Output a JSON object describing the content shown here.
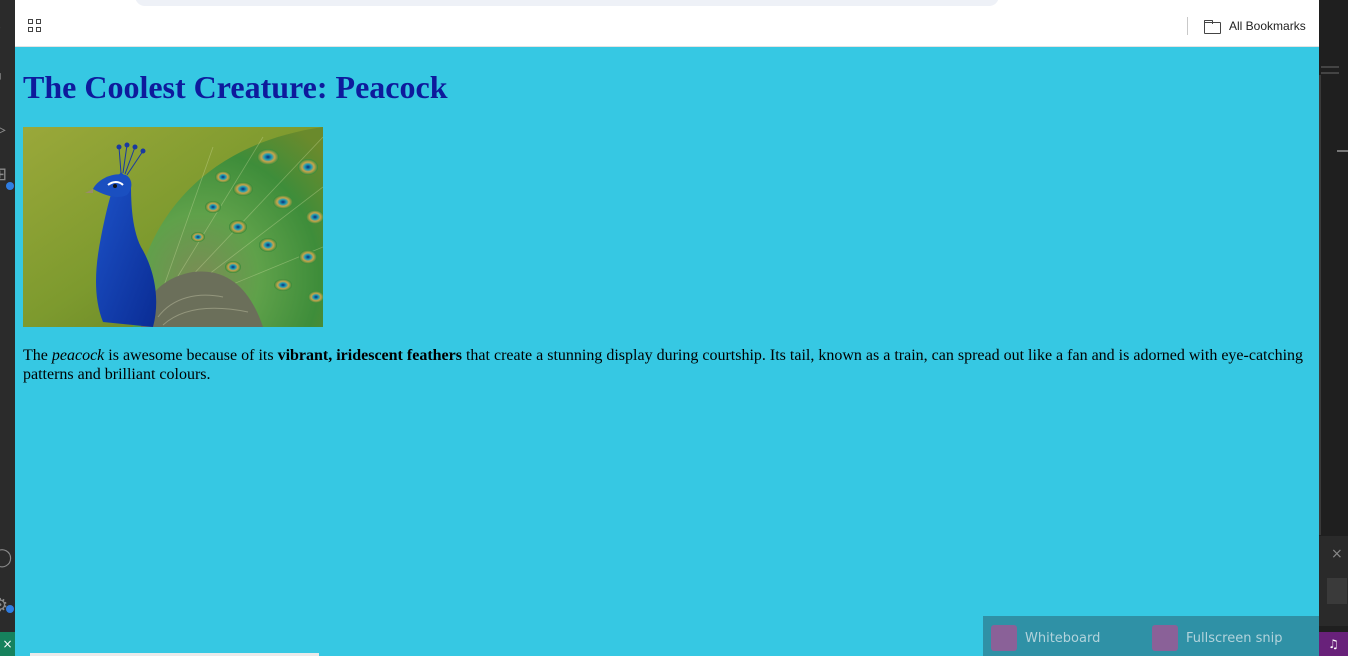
{
  "toolbar": {
    "bookmarks_label": "All Bookmarks"
  },
  "page": {
    "title": "The Coolest Creature: Peacock",
    "image_alt": "peacock",
    "paragraph": {
      "part1": "The ",
      "em": "peacock",
      "part2": " is awesome because of its ",
      "strong": "vibrant, iridescent feathers",
      "part3": " that create a stunning display during courtship. Its tail, known as a train, can spread out like a fan and is adorned with eye-catching patterns and brilliant colours."
    }
  },
  "snip_toolbar": {
    "items": [
      {
        "label": "Whiteboard"
      },
      {
        "label": "Fullscreen snip"
      }
    ]
  },
  "colors": {
    "page_background": "#36c8e3",
    "title_color": "#0e1a9c"
  }
}
